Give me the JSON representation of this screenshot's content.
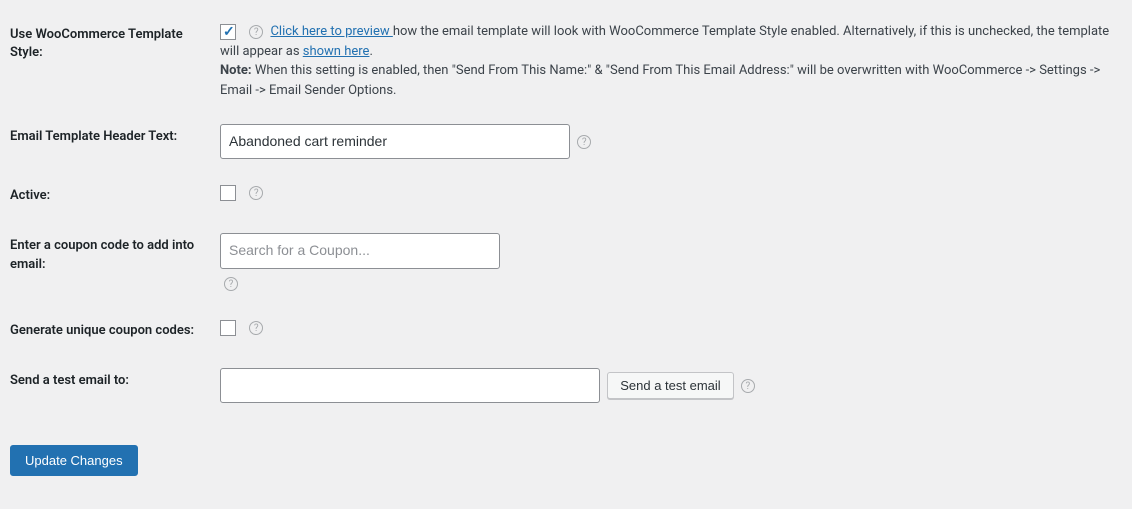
{
  "rows": {
    "use_template": {
      "label": "Use WooCommerce Template Style:",
      "link_preview": "Click here to preview ",
      "desc1": "how the email template will look with WooCommerce Template Style enabled. Alternatively, if this is unchecked, the template will appear as ",
      "link_shown": "shown here",
      "desc2": ".",
      "note_label": "Note:",
      "note_text": " When this setting is enabled, then \"Send From This Name:\" & \"Send From This Email Address:\" will be overwritten with WooCommerce -> Settings -> Email -> Email Sender Options."
    },
    "header_text": {
      "label": "Email Template Header Text:",
      "value": "Abandoned cart reminder"
    },
    "active": {
      "label": "Active:"
    },
    "coupon_code": {
      "label": "Enter a coupon code to add into email:",
      "placeholder": "Search for a Coupon..."
    },
    "unique_coupon": {
      "label": "Generate unique coupon codes:"
    },
    "test_email": {
      "label": "Send a test email to:",
      "button": "Send a test email"
    }
  },
  "submit": {
    "label": "Update Changes"
  }
}
